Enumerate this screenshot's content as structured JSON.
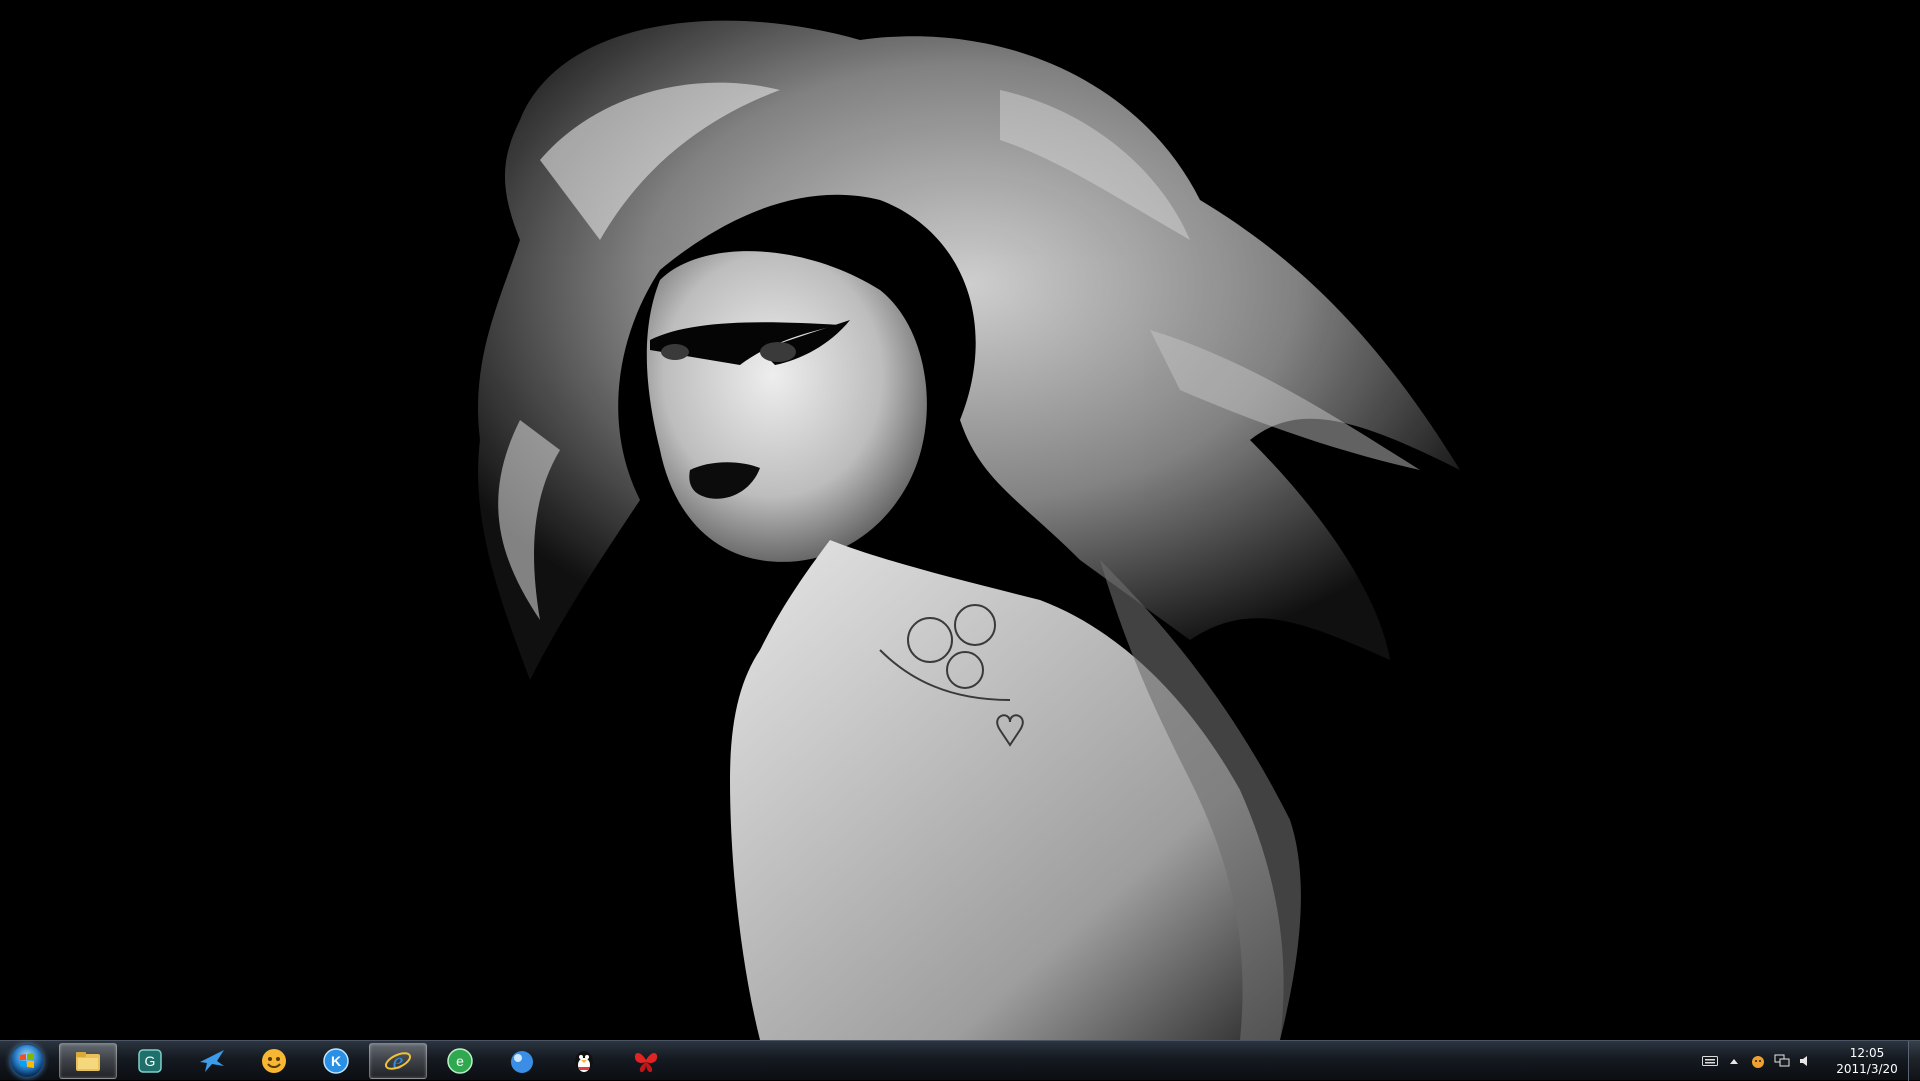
{
  "desktop": {
    "wallpaper": "black-and-white portrait"
  },
  "taskbar": {
    "start_icon": "windows-orb-icon",
    "pinned": [
      {
        "name": "file-explorer-icon",
        "active": true
      },
      {
        "name": "app-g-icon",
        "active": false
      },
      {
        "name": "bird-app-icon",
        "active": false
      },
      {
        "name": "smiley-app-icon",
        "active": false
      },
      {
        "name": "kugou-k-icon",
        "active": false
      },
      {
        "name": "internet-explorer-icon",
        "active": true
      },
      {
        "name": "360-browser-icon",
        "active": false
      },
      {
        "name": "blue-bubble-app-icon",
        "active": false
      },
      {
        "name": "qq-penguin-icon",
        "active": false
      },
      {
        "name": "red-butterfly-icon",
        "active": false
      }
    ],
    "tray": {
      "icons": [
        "keyboard-icon",
        "show-hidden-icons-icon",
        "pet-icon",
        "network-icon",
        "volume-icon"
      ],
      "time": "12:05",
      "date": "2011/3/20"
    }
  },
  "colors": {
    "taskbar_top": "#2b3440",
    "taskbar_bottom": "#0b0e12",
    "accent_blue": "#2a7fc9"
  }
}
